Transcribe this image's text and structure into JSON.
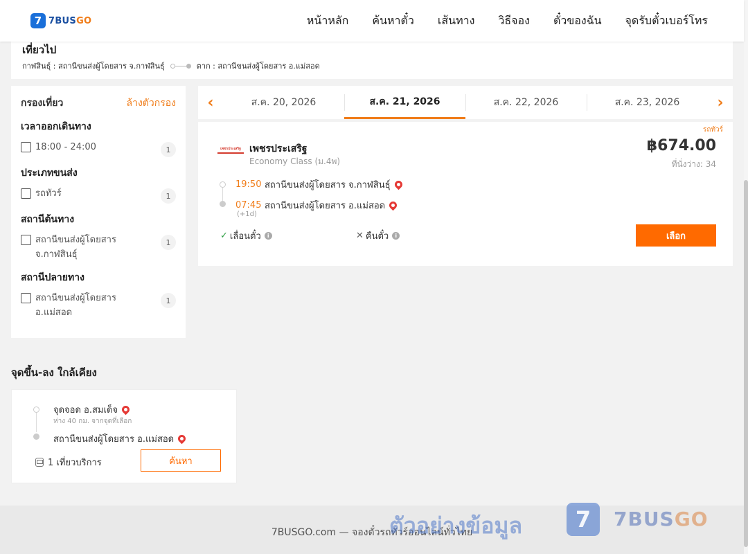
{
  "header": {
    "logo_mark": "7",
    "logo_text_a": "7BUS",
    "logo_text_b": "GO",
    "nav": [
      "หน้าหลัก",
      "ค้นหาตั๋ว",
      "เส้นทาง",
      "วิธีจอง",
      "ตั๋วของฉัน",
      "จุดรับตั๋วเบอร์โทร"
    ]
  },
  "route": {
    "title": "เที่ยวไป",
    "from": "กาฬสินธุ์ : สถานีขนส่งผู้โดยสาร จ.กาฬสินธุ์",
    "to": "ตาก : สถานีขนส่งผู้โดยสาร อ.แม่สอด"
  },
  "filters": {
    "title": "กรองเที่ยว",
    "clear": "ล้างตัวกรอง",
    "groups": [
      {
        "title": "เวลาออกเดินทาง",
        "option": "18:00 - 24:00",
        "count": "1"
      },
      {
        "title": "ประเภทขนส่ง",
        "option": "รถทัวร์",
        "count": "1"
      },
      {
        "title": "สถานีต้นทาง",
        "option": "สถานีขนส่งผู้โดยสาร จ.กาฬสินธุ์",
        "count": "1"
      },
      {
        "title": "สถานีปลายทาง",
        "option": "สถานีขนส่งผู้โดยสาร อ.แม่สอด",
        "count": "1"
      }
    ]
  },
  "dates": {
    "prev": "‹",
    "next": "›",
    "tabs": [
      "ส.ค. 20, 2026",
      "ส.ค. 21, 2026",
      "ส.ค. 22, 2026",
      "ส.ค. 23, 2026"
    ],
    "active_index": 1
  },
  "trip": {
    "tag": "รถทัวร์",
    "operator_logo": "เพชรประเสริฐ",
    "operator": "เพชรประเสริฐ",
    "class": "Economy Class (ม.4พ)",
    "price": "฿674.00",
    "seats": "ที่นั่งว่าง: 34",
    "depart_time": "19:50",
    "depart_station": "สถานีขนส่งผู้โดยสาร จ.กาฬสินธุ์",
    "arrive_time": "07:45",
    "arrive_station": "สถานีขนส่งผู้โดยสาร อ.แม่สอด",
    "plus_day": "(+1d)",
    "reschedule": "เลื่อนตั๋ว",
    "refund": "คืนตั๋ว",
    "select": "เลือก"
  },
  "nearby": {
    "title": "จุดขึ้น-ลง ใกล้เคียง",
    "stop1": "จุดจอด อ.สมเด็จ",
    "distance": "ห่าง 40 กม. จากจุดที่เลือก",
    "stop2": "สถานีขนส่งผู้โดยสาร อ.แม่สอด",
    "trips": "1 เที่ยวบริการ",
    "search": "ค้นหา"
  },
  "footer": {
    "text": "7BUSGO.com — จองตั๋วรถทัวร์ออนไลน์ทั่วไทย",
    "watermark": "ตัวอย่างข้อมูล",
    "wm_logo": "7",
    "wm_brand_a": "7BUS",
    "wm_brand_b": "GO"
  },
  "colors": {
    "accent": "#f07d1a",
    "button": "#ff6a00",
    "brand_blue": "#1a6fd9",
    "pin": "#e53935"
  }
}
